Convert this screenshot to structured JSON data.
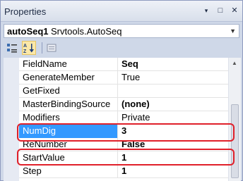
{
  "window": {
    "title": "Properties"
  },
  "title_controls": {
    "dropdown_glyph": "▾",
    "pin_glyph": "□",
    "close_glyph": "✕"
  },
  "object_selector": {
    "name": "autoSeq1",
    "type": "Srvtools.AutoSeq",
    "arrow_glyph": "▼"
  },
  "toolbar": {
    "categorized_icon": "categorized-icon",
    "alphabetical_icon": "alphabetical-icon",
    "property_pages_icon": "property-pages-icon"
  },
  "properties": [
    {
      "name": "FieldName",
      "value": "Seq",
      "bold": true
    },
    {
      "name": "GenerateMember",
      "value": "True",
      "bold": false
    },
    {
      "name": "GetFixed",
      "value": "",
      "bold": false
    },
    {
      "name": "MasterBindingSource",
      "value": "(none)",
      "bold": true
    },
    {
      "name": "Modifiers",
      "value": "Private",
      "bold": false
    },
    {
      "name": "NumDig",
      "value": "3",
      "bold": true,
      "selected": true
    },
    {
      "name": "ReNumber",
      "value": "False",
      "bold": true
    },
    {
      "name": "StartValue",
      "value": "1",
      "bold": true
    },
    {
      "name": "Step",
      "value": "1",
      "bold": true
    }
  ],
  "highlight_color": "#e0202a",
  "selection_color": "#3399ff"
}
